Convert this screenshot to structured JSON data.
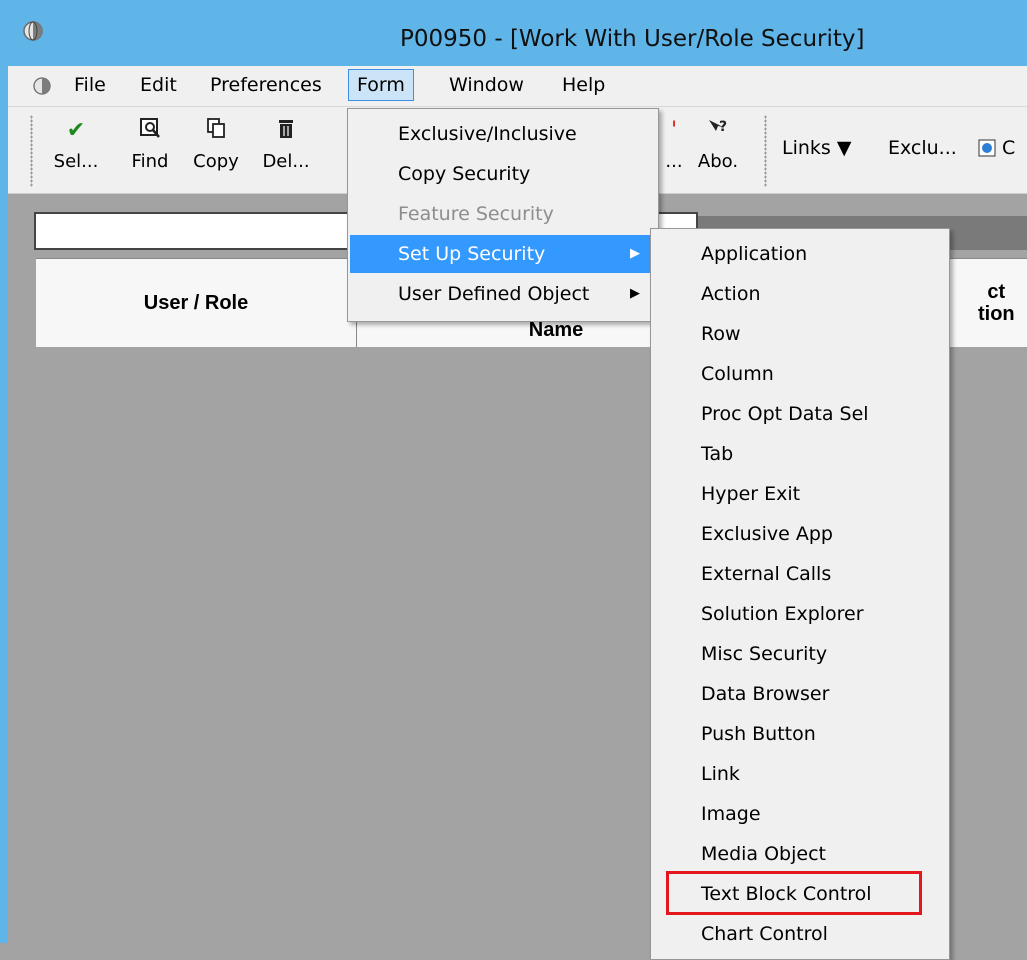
{
  "window": {
    "title": "P00950 - [Work With User/Role Security]"
  },
  "menubar": {
    "items": [
      "File",
      "Edit",
      "Preferences",
      "Form",
      "Window",
      "Help"
    ],
    "active": "Form"
  },
  "toolbar": {
    "buttons": [
      {
        "label": "Sel...",
        "icon": "checkmark-icon"
      },
      {
        "label": "Find",
        "icon": "find-icon"
      },
      {
        "label": "Copy",
        "icon": "copy-icon"
      },
      {
        "label": "Del...",
        "icon": "trash-icon"
      },
      {
        "label": "...",
        "icon": "hidden-icon"
      },
      {
        "label": "Abo.",
        "icon": "about-icon"
      }
    ],
    "links_label": "Links",
    "exclu_label": "Exclu...",
    "trailing_label": "C"
  },
  "grid": {
    "columns": [
      "User / Role",
      "Name",
      "ct\ntion"
    ]
  },
  "form_menu": {
    "items": [
      {
        "label": "Exclusive/Inclusive",
        "state": "normal"
      },
      {
        "label": "Copy Security",
        "state": "normal"
      },
      {
        "label": "Feature Security",
        "state": "disabled"
      },
      {
        "label": "Set Up Security",
        "state": "highlighted",
        "submenu": true
      },
      {
        "label": "User Defined Object",
        "state": "normal",
        "submenu": true
      }
    ]
  },
  "security_submenu": {
    "items": [
      "Application",
      "Action",
      "Row",
      "Column",
      "Proc Opt Data Sel",
      "Tab",
      "Hyper Exit",
      "Exclusive App",
      "External Calls",
      "Solution Explorer",
      "Misc Security",
      "Data Browser",
      "Push Button",
      "Link",
      "Image",
      "Media Object",
      "Text Block Control",
      "Chart Control"
    ],
    "emphasized": "Text Block Control"
  },
  "colors": {
    "titlebar": "#5fb4e8",
    "highlight": "#3399ff",
    "emphasis_box": "#e5171d"
  }
}
